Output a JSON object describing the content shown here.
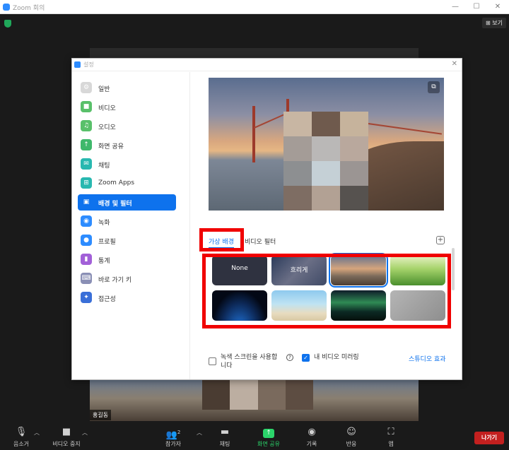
{
  "window": {
    "title": "Zoom 회의",
    "controls": [
      "—",
      "☐",
      "✕"
    ]
  },
  "meeting": {
    "view_button": "보기",
    "participant_name": "홍길동"
  },
  "toolbar": {
    "mute": "음소거",
    "stop_video": "비디오 중지",
    "participants": "참가자",
    "participant_count": "2",
    "chat": "채팅",
    "share": "화면 공유",
    "record": "기록",
    "reactions": "반응",
    "apps": "앱",
    "leave": "나가기"
  },
  "settings": {
    "title": "설정",
    "close": "✕",
    "sidebar": [
      {
        "label": "일반",
        "icon": "gear-icon",
        "color": "#d8d8d8",
        "glyph": "⚙"
      },
      {
        "label": "비디오",
        "icon": "video-icon",
        "color": "#59c06a",
        "glyph": "■"
      },
      {
        "label": "오디오",
        "icon": "headphones-icon",
        "color": "#59c06a",
        "glyph": "♫"
      },
      {
        "label": "화면 공유",
        "icon": "share-screen-icon",
        "color": "#3fb86b",
        "glyph": "↑"
      },
      {
        "label": "채팅",
        "icon": "chat-icon",
        "color": "#28b8b0",
        "glyph": "✉"
      },
      {
        "label": "Zoom Apps",
        "icon": "apps-icon",
        "color": "#28b8b0",
        "glyph": "⊞"
      },
      {
        "label": "배경 및 필터",
        "icon": "background-icon",
        "color": "#0e72ed",
        "glyph": "▣"
      },
      {
        "label": "녹화",
        "icon": "record-icon",
        "color": "#2d8cff",
        "glyph": "◉"
      },
      {
        "label": "프로필",
        "icon": "profile-icon",
        "color": "#2d8cff",
        "glyph": "●"
      },
      {
        "label": "통계",
        "icon": "stats-icon",
        "color": "#a260d8",
        "glyph": "▮"
      },
      {
        "label": "바로 가기 키",
        "icon": "keyboard-icon",
        "color": "#8a8fb5",
        "glyph": "⌨"
      },
      {
        "label": "접근성",
        "icon": "accessibility-icon",
        "color": "#3a6fd8",
        "glyph": "✦"
      }
    ],
    "active_index": 6,
    "tabs": {
      "virtual_background": "가상 배경",
      "video_filter": "비디오 필터"
    },
    "backgrounds": [
      {
        "label": "None",
        "kind": "none"
      },
      {
        "label": "흐리게",
        "kind": "blur"
      },
      {
        "label": "",
        "kind": "golden-gate",
        "selected": true
      },
      {
        "label": "",
        "kind": "grass"
      },
      {
        "label": "",
        "kind": "earth"
      },
      {
        "label": "",
        "kind": "beach"
      },
      {
        "label": "",
        "kind": "aurora"
      },
      {
        "label": "",
        "kind": "gray"
      }
    ],
    "green_screen": {
      "label_line1": "녹색 스크린을 사용합",
      "label_line2": "니다",
      "checked": false
    },
    "mirror": {
      "label": "내 비디오 미러링",
      "checked": true
    },
    "studio_effects": "스튜디오 효과"
  }
}
